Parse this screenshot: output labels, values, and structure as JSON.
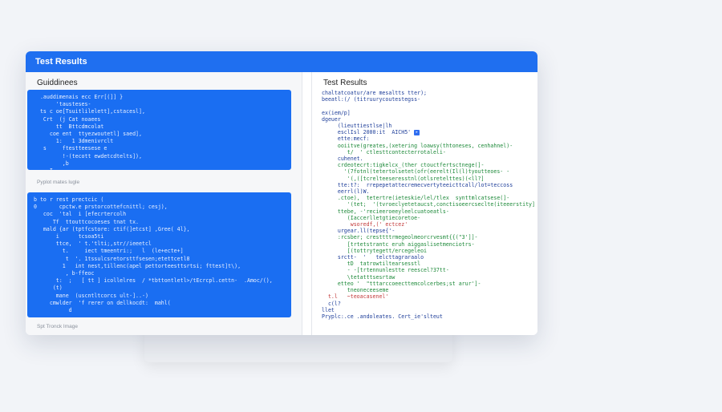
{
  "window": {
    "title": "Test Results"
  },
  "left": {
    "heading": "Guiddinees",
    "code_top": [
      "  .auddimenais ecc Err[(]] }",
      "       'tausteses-",
      "  ts c oe[Tsuitlilelett],cstacesl],",
      "   Crt  (j Cat noaees",
      "       tt  Bttcdmcolat",
      "     coe ent  ttyezwoutetl] saed],",
      "       1:   1 3dmenivrclt",
      "   s     ftestteesese e",
      "         !-(tecott ewdetcdtelts]),",
      "         ,b",
      "     I"
    ],
    "caption_top": "Pyplot mates lugle",
    "code_bottom": [
      "b to r rest prectcic (",
      "0       cpctw.e prstorcottefcnittl; cesj),",
      "   coc  'tal  i [efecrtercolh",
      "      Tf  ttouttcocoeses tnat tx.",
      "",
      "   mald {ar (tptfcstore: ctif(]etcst] ,Gree( 4l},",
      "       i      tcsoa5ti",
      "       ttce,  ' t.'tlti;,str//ieeetcl",
      "         t.     iect tmeentri:;   l  (le+ecte+]",
      "          t  '. 1tssulcsretorsttfsesen;etettcetl8",
      "         1   int nest,tillenc(apel pettorteesttsrtsi; fttest]t\\),",
      "          , b-ffeoc",
      "",
      "       t:  ;   [ tt ] icollelres  / *tbttontletl>/tEcrcpl.cettn-  .Amoc/(),",
      "      (t)",
      "",
      "       mane  (uscntltcorcs ult-]..-)",
      "",
      "     cmwlder  'f rerer on dellkocdt:  mahl(",
      "           d"
    ],
    "caption_bottom": "Spt Tronck Image"
  },
  "right": {
    "heading": "Test Results",
    "lines": [
      {
        "t": "chaltatcoatur/are mesaltts tter);",
        "c": "blue"
      },
      {
        "t": "beeatl:(/ (titruurycoutestegss-",
        "c": "blue"
      },
      {
        "t": "",
        "c": "blue"
      },
      {
        "t": "ex(iem/p]",
        "c": "blue"
      },
      {
        "t": "dgeuer",
        "c": "blue"
      },
      {
        "t": "     (lieuttiestlse|lh",
        "c": "blue"
      },
      {
        "t": "     esclIsl 2000:it  AICH5'",
        "c": "blue",
        "badge": true
      },
      {
        "t": "     ette:mecf:",
        "c": "blue"
      },
      {
        "t": "     ooiitve(greates,(xetering loawsy(thtoneses, cenhahnel)-",
        "c": "green"
      },
      {
        "t": "        t/  ' ctlesttcontecterrotaleli-",
        "c": "green"
      },
      {
        "t": "     cuhenet.",
        "c": "blue"
      },
      {
        "t": "     crdeotecrt:tigkelcx_(ther ctouctfertsctnege(]-",
        "c": "green"
      },
      {
        "t": "       '(7fotnl(tetertolsetet(ofr(eerelt(Il(l)tyoutteoes- -",
        "c": "green"
      },
      {
        "t": "        '(,([tcrelteeseresstnl(otlsretelttes)(<ll?]",
        "c": "green"
      },
      {
        "t": "     tte:t?:  rrepepetattecremecvertyteeicttcall/lot=teccoss",
        "c": "blue"
      },
      {
        "t": "     eerrl(l)W.",
        "c": "blue"
      },
      {
        "t": "     .ctoe),  tetertre(ieteskie/lel/tlex  synttmlcatsese(]-",
        "c": "green"
      },
      {
        "t": "        '(tet;  '(tvroeclyetetaucst,conctisoeercseclte(iteeerstity]-",
        "c": "green"
      },
      {
        "t": "     ttebe, -'recieeroeeyleelcuatoeatls-",
        "c": "green"
      },
      {
        "t": "        (Iaccerlletgtiecoretoe-",
        "c": "green"
      },
      {
        "t": "         wsoredf,(' ectcez'",
        "c": "red"
      },
      {
        "t": "     urgear.ll(tepse{'-",
        "c": "blue"
      },
      {
        "t": "     :rcsber; cresttttrmegeolmeorcrvesmt{{(\"3']]-",
        "c": "green"
      },
      {
        "t": "        [trtetstrantc eruh aiggaslisetmenciotrs-",
        "c": "green"
      },
      {
        "t": "        [(tottrytegett/ercegeleoi",
        "c": "green"
      },
      {
        "t": "     srctt-  '   telcttagraraalo",
        "c": "blue"
      },
      {
        "t": "        tD  tatrowtiltearsesstl",
        "c": "green"
      },
      {
        "t": "        - -[trtennunlestte reescel?37tt-",
        "c": "green"
      },
      {
        "t": "        \\tetatttsesrtaw",
        "c": "green"
      },
      {
        "t": "     etteo '  \"tttarccoeecttemcolcerbes;st arur']-",
        "c": "green"
      },
      {
        "t": "        tneoneceeseme",
        "c": "green"
      },
      {
        "t": "  t.l   ~teoacasenel'",
        "c": "red"
      },
      {
        "t": "  c(l?",
        "c": "blue"
      },
      {
        "t": "llet",
        "c": "blue"
      },
      {
        "t": "Pryplc:.ce .andoleates. Cert_ie'slteut",
        "c": "blue"
      }
    ]
  }
}
